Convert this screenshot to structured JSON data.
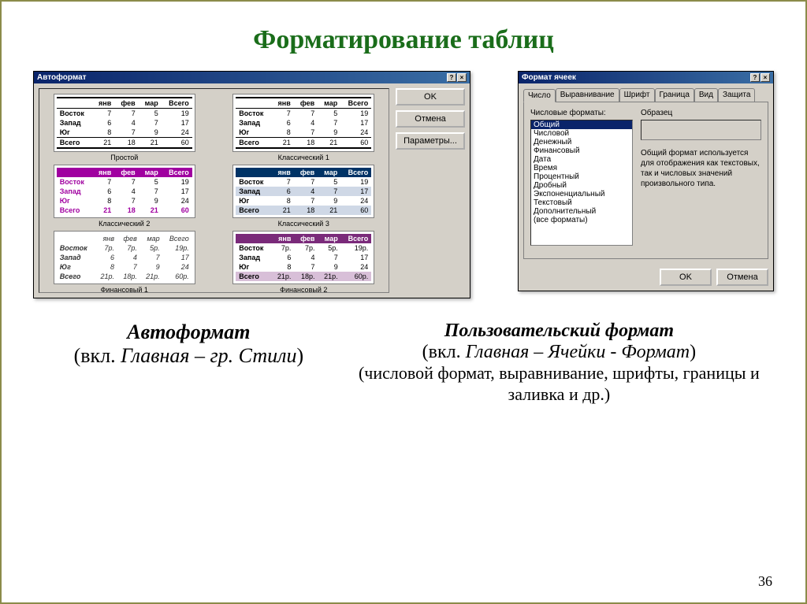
{
  "slide": {
    "title": "Форматирование таблиц",
    "page_number": "36"
  },
  "autoformat": {
    "window_title": "Автоформат",
    "buttons": {
      "ok": "OK",
      "cancel": "Отмена",
      "options": "Параметры..."
    },
    "rows": [
      "Восток",
      "Запад",
      "Юг",
      "Всего"
    ],
    "cols": [
      "янв",
      "фев",
      "мар",
      "Всего"
    ],
    "data": [
      [
        7,
        7,
        5,
        19
      ],
      [
        6,
        4,
        7,
        17
      ],
      [
        8,
        7,
        9,
        24
      ],
      [
        21,
        18,
        21,
        60
      ]
    ],
    "data_rub": [
      [
        "7р.",
        "7р.",
        "5р.",
        "19р."
      ],
      [
        "6",
        "4",
        "7",
        "17"
      ],
      [
        "8",
        "7",
        "9",
        "24"
      ],
      [
        "21р.",
        "18р.",
        "21р.",
        "60р."
      ]
    ],
    "styles": [
      "Простой",
      "Классический 1",
      "Классический 2",
      "Классический 3",
      "Финансовый 1",
      "Финансовый 2"
    ]
  },
  "format_cells": {
    "window_title": "Формат ячеек",
    "tabs": [
      "Число",
      "Выравнивание",
      "Шрифт",
      "Граница",
      "Вид",
      "Защита"
    ],
    "list_label": "Числовые форматы:",
    "sample_label": "Образец",
    "formats": [
      "Общий",
      "Числовой",
      "Денежный",
      "Финансовый",
      "Дата",
      "Время",
      "Процентный",
      "Дробный",
      "Экспоненциальный",
      "Текстовый",
      "Дополнительный",
      "(все форматы)"
    ],
    "hint": "Общий формат используется для отображения как текстовых, так и числовых значений произвольного типа.",
    "buttons": {
      "ok": "OK",
      "cancel": "Отмена"
    }
  },
  "captions": {
    "left_title": "Автоформат",
    "left_sub_a": "(вкл. ",
    "left_sub_b": "Главная – гр. Стили",
    "left_sub_c": ")",
    "right_title": "Пользовательский формат",
    "right_sub1_a": "(вкл. ",
    "right_sub1_b": "Главная – Ячейки - Формат",
    "right_sub1_c": ")",
    "right_sub2": "(числовой формат, выравнивание, шрифты, границы и заливка и др.)"
  }
}
